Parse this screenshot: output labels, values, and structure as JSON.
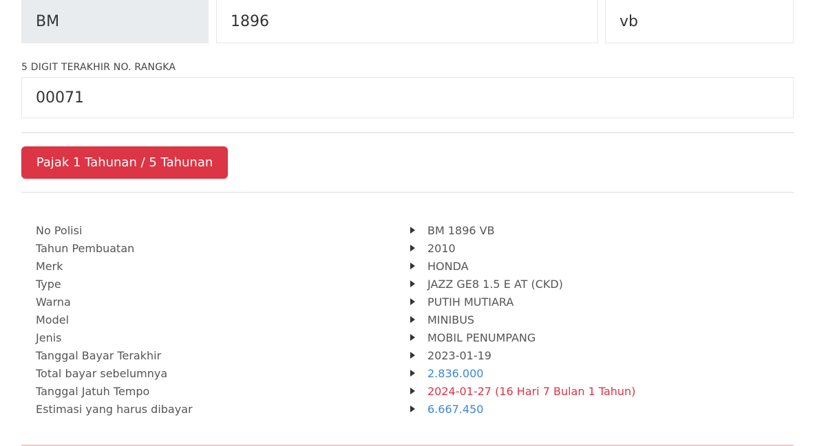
{
  "plate": {
    "prefix": "BM",
    "number": "1896",
    "suffix": "vb"
  },
  "rangka": {
    "label": "5 DIGIT TERAKHIR NO. RANGKA",
    "value": "00071"
  },
  "tax_button_label": "Pajak 1 Tahunan / 5 Tahunan",
  "colors": {
    "button": "#dc3545",
    "link_blue": "#3b86d8",
    "due_red": "#dc3545"
  },
  "details": [
    {
      "label": "No Polisi",
      "value": "BM 1896 VB"
    },
    {
      "label": "Tahun Pembuatan",
      "value": "2010"
    },
    {
      "label": "Merk",
      "value": "HONDA"
    },
    {
      "label": "Type",
      "value": "JAZZ GE8 1.5 E AT (CKD)"
    },
    {
      "label": "Warna",
      "value": "PUTIH MUTIARA"
    },
    {
      "label": "Model",
      "value": "MINIBUS"
    },
    {
      "label": "Jenis",
      "value": "MOBIL PENUMPANG"
    },
    {
      "label": "Tanggal Bayar Terakhir",
      "value": "2023-01-19"
    },
    {
      "label": "Total bayar sebelumnya",
      "value": "2.836.000"
    },
    {
      "label": "Tanggal Jatuh Tempo",
      "value": "2024-01-27 (16 Hari 7 Bulan 1 Tahun)"
    },
    {
      "label": "Estimasi yang harus dibayar",
      "value": "6.667.450"
    }
  ]
}
